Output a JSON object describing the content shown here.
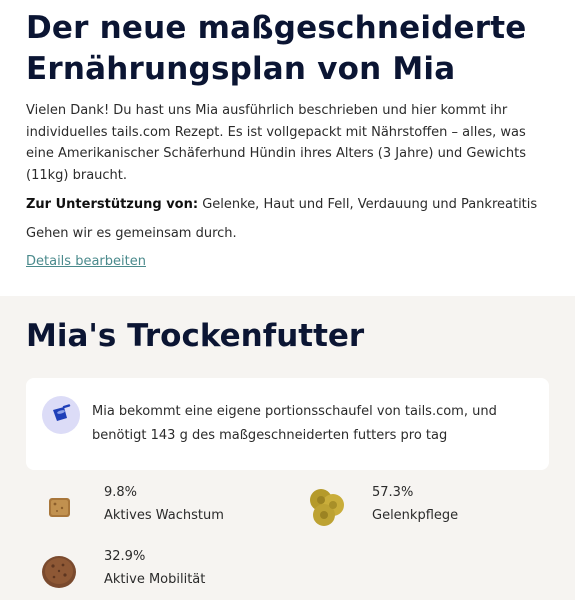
{
  "plan": {
    "title": "Der neue maßgeschneiderte Ernährungsplan von Mia",
    "intro": "Vielen Dank! Du hast uns Mia ausführlich beschrieben und hier kommt ihr individuelles tails.com Rezept. Es ist vollgepackt mit Nährstoffen – alles, was eine Amerikanischer Schäferhund Hündin ihres Alters (3 Jahre) und Gewichts (11kg) braucht.",
    "support_label": "Zur Unterstützung von:",
    "support_value": "Gelenke, Haut und Fell, Verdauung und Pankreatitis",
    "walkthrough": "Gehen wir es gemeinsam durch.",
    "edit_link": "Details bearbeiten"
  },
  "dry_food": {
    "title": "Mia's Trockenfutter",
    "scoop_icon": "scoop-icon",
    "scoop_text_line1": "Mia bekommt eine eigene portionsschaufel von tails.com, und",
    "scoop_text_line2": "benötigt 143 g des maßgeschneiderten futters pro tag",
    "ingredients": [
      {
        "percent": "9.8%",
        "name": "Aktives Wachstum",
        "icon": "kibble-cube-icon"
      },
      {
        "percent": "57.3%",
        "name": "Gelenkpflege",
        "icon": "kibble-cluster-icon"
      },
      {
        "percent": "32.9%",
        "name": "Aktive Mobilität",
        "icon": "kibble-round-icon"
      }
    ]
  },
  "colors": {
    "heading": "#0b1533",
    "link": "#4a8a8c",
    "section_bg": "#f6f4f1",
    "icon_bg": "#dcdcf7",
    "scoop_blue": "#1f3fb8"
  }
}
